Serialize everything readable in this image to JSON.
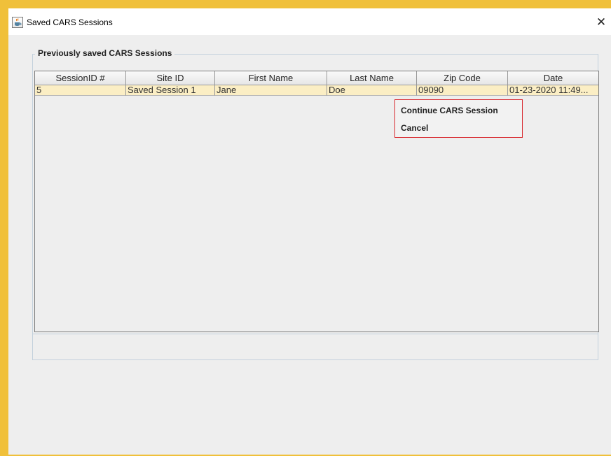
{
  "window": {
    "title": "Saved CARS Sessions",
    "app_icon": "java-cup-icon",
    "close_glyph": "✕"
  },
  "group": {
    "title": "Previously saved CARS Sessions"
  },
  "table": {
    "columns": [
      "SessionID #",
      "Site ID",
      "First Name",
      "Last Name",
      "Zip Code",
      "Date"
    ],
    "rows": [
      [
        "5",
        "Saved Session 1",
        "Jane",
        "Doe",
        "09090",
        "01-23-2020 11:49..."
      ]
    ]
  },
  "context_menu": {
    "items": [
      "Continue CARS Session",
      "Cancel"
    ]
  },
  "colors": {
    "selected_row": "#fbeec4",
    "menu_border": "#d8272d",
    "desktop_accent": "#f0c03a"
  }
}
